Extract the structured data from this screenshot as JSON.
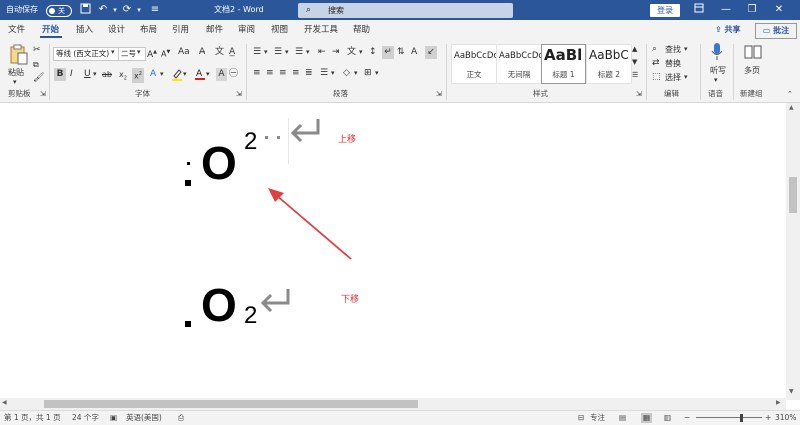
{
  "window": {
    "autosave_label": "自动保存",
    "autosave_state": "关",
    "title": "文档2 - Word",
    "search_placeholder": "搜索",
    "login_label": "登录"
  },
  "tabs": [
    "文件",
    "开始",
    "插入",
    "设计",
    "布局",
    "引用",
    "邮件",
    "审阅",
    "视图",
    "开发工具",
    "帮助"
  ],
  "active_tab": "开始",
  "share_label": "共享",
  "comment_label": "批注",
  "ribbon": {
    "paste_label": "粘贴",
    "font_name": "等线 (西文正文)",
    "font_size": "二号",
    "styles": [
      {
        "preview": "AaBbCcDc",
        "name": "正文"
      },
      {
        "preview": "AaBbCcDc",
        "name": "无间隔"
      },
      {
        "preview": "AaBl",
        "name": "标题 1"
      },
      {
        "preview": "AaBbC",
        "name": "标题 2"
      }
    ],
    "find_label": "查找",
    "replace_label": "替换",
    "select_label": "选择",
    "dictate_label": "听写",
    "multipage_label": "多页",
    "groups": {
      "clipboard": "剪贴板",
      "font": "字体",
      "paragraph": "段落",
      "styles": "样式",
      "editing": "编辑",
      "voice": "语音",
      "new_group": "新建组"
    }
  },
  "document": {
    "formula1_main": "O",
    "formula1_sup": "2",
    "note1": "上移",
    "formula2_main": "O",
    "formula2_sub": "2",
    "note2": "下移"
  },
  "status": {
    "page": "第 1 页，共 1 页",
    "words": "24 个字",
    "language": "英语(美国)",
    "focus": "专注",
    "zoom": "310%"
  },
  "colors": {
    "accent": "#2b579a",
    "note_red": "#e03030",
    "arrow_red": "#e04040"
  }
}
